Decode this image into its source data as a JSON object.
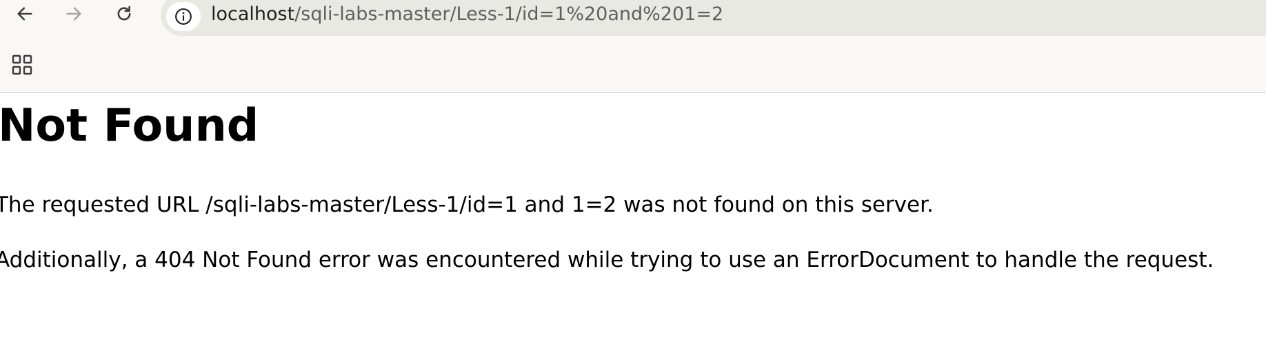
{
  "browser": {
    "icons": {
      "back": "arrow-left-icon",
      "forward": "arrow-right-icon",
      "reload": "reload-icon",
      "site_info": "info-icon",
      "apps": "apps-grid-icon"
    },
    "address_bar": {
      "host": "localhost",
      "path": "/sqli-labs-master/Less-1/id=1%20and%201=2"
    }
  },
  "page": {
    "heading": "Not Found",
    "message": "The requested URL /sqli-labs-master/Less-1/id=1 and 1=2 was not found on this server.",
    "additional": "Additionally, a 404 Not Found error was encountered while trying to use an ErrorDocument to handle the request."
  },
  "colors": {
    "toolbar_bg": "#f9f8f5",
    "omnibox_bg": "#e9e9e4",
    "text": "#000000"
  }
}
